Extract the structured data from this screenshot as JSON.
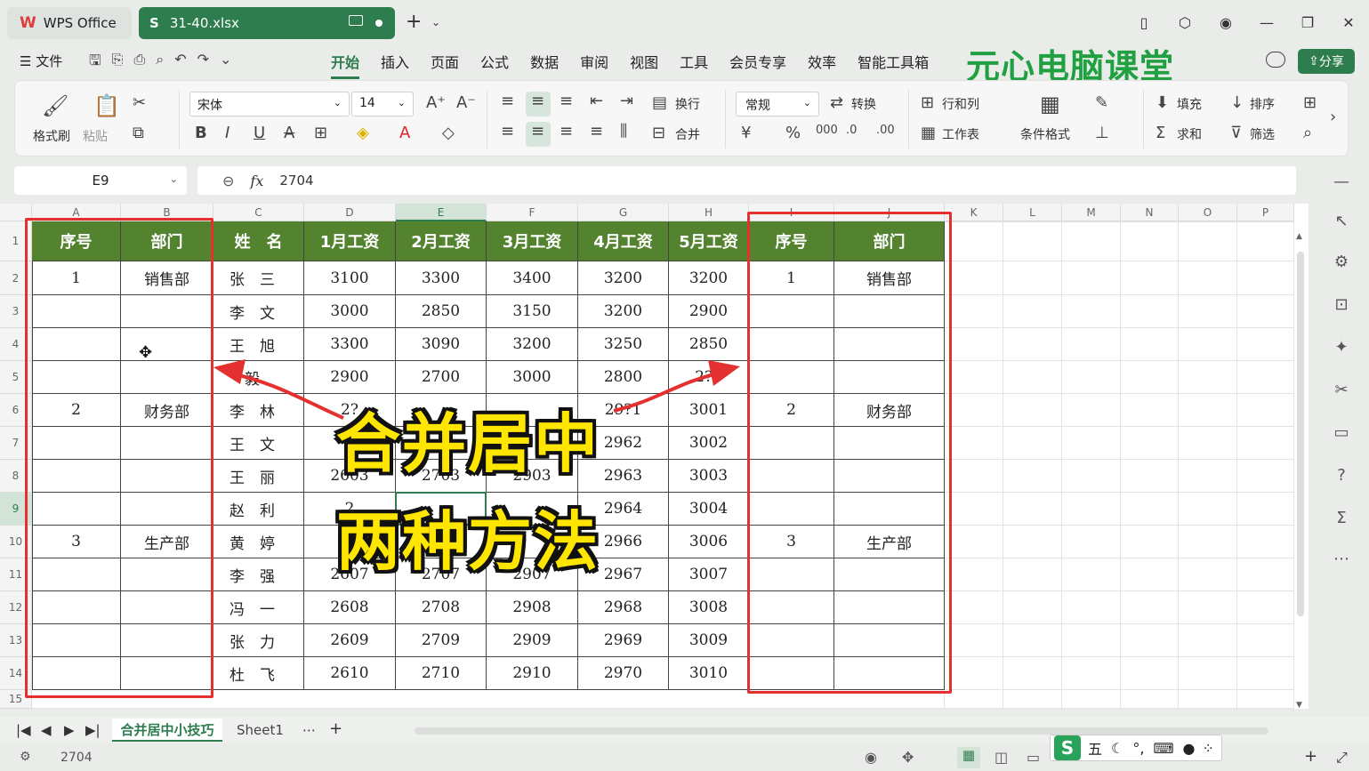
{
  "titlebar": {
    "app_tab": "WPS Office",
    "file_tab": "31-40.xlsx",
    "file_icon": "S"
  },
  "menu": {
    "file": "文件",
    "items": [
      "开始",
      "插入",
      "页面",
      "公式",
      "数据",
      "审阅",
      "视图",
      "工具",
      "会员专享",
      "效率",
      "智能工具箱"
    ],
    "active": "开始",
    "share": "分享"
  },
  "brand": "元心电脑课堂",
  "ribbon": {
    "format_painter": "格式刷",
    "paste": "粘贴",
    "font_name": "宋体",
    "font_size": "14",
    "wrap": "换行",
    "merge": "合并",
    "number_format": "常规",
    "convert": "转换",
    "row_col": "行和列",
    "worksheet": "工作表",
    "cond_format": "条件格式",
    "fill": "填充",
    "sort": "排序",
    "sum": "求和",
    "filter": "筛选"
  },
  "namebox": "E9",
  "formula_value": "2704",
  "columns": [
    "A",
    "B",
    "C",
    "D",
    "E",
    "F",
    "G",
    "H",
    "I",
    "J",
    "K",
    "L",
    "M",
    "N",
    "O",
    "P"
  ],
  "selected_column": "E",
  "rows": [
    "1",
    "2",
    "3",
    "4",
    "5",
    "6",
    "7",
    "8",
    "9",
    "10",
    "11",
    "12",
    "13",
    "14",
    "15"
  ],
  "selected_row": "9",
  "table": {
    "headers": [
      "序号",
      "部门",
      "姓　名",
      "1月工资",
      "2月工资",
      "3月工资",
      "4月工资",
      "5月工资",
      "序号",
      "部门"
    ],
    "rows": [
      [
        "1",
        "销售部",
        "张　三",
        "3100",
        "3300",
        "3400",
        "3200",
        "3200",
        "1",
        "销售部"
      ],
      [
        "",
        "",
        "李　文",
        "3000",
        "2850",
        "3150",
        "3200",
        "2900",
        "",
        ""
      ],
      [
        "",
        "",
        "王　旭",
        "3300",
        "3090",
        "3200",
        "3250",
        "2850",
        "",
        ""
      ],
      [
        "",
        "",
        "　毅",
        "2900",
        "2700",
        "3000",
        "2800",
        "2?0",
        "",
        ""
      ],
      [
        "2",
        "财务部",
        "李　林",
        "2?",
        "",
        "",
        "29?1",
        "3001",
        "2",
        "财务部"
      ],
      [
        "",
        "",
        "王　文",
        "2",
        "",
        "",
        "2962",
        "3002",
        "",
        ""
      ],
      [
        "",
        "",
        "王　丽",
        "2603",
        "2703",
        "2903",
        "2963",
        "3003",
        "",
        ""
      ],
      [
        "",
        "",
        "赵　利",
        "2",
        "",
        "",
        "2964",
        "3004",
        "",
        ""
      ],
      [
        "3",
        "生产部",
        "黄　婷",
        "2",
        "",
        "",
        "2966",
        "3006",
        "3",
        "生产部"
      ],
      [
        "",
        "",
        "李　强",
        "2607",
        "2707",
        "2907",
        "2967",
        "3007",
        "",
        ""
      ],
      [
        "",
        "",
        "冯　一",
        "2608",
        "2708",
        "2908",
        "2968",
        "3008",
        "",
        ""
      ],
      [
        "",
        "",
        "张　力",
        "2609",
        "2709",
        "2909",
        "2969",
        "3009",
        "",
        ""
      ],
      [
        "",
        "",
        "杜　飞",
        "2610",
        "2710",
        "2910",
        "2970",
        "3010",
        "",
        ""
      ]
    ]
  },
  "overlay": {
    "line1": "合并居中",
    "line2": "两种方法"
  },
  "sheet_tabs": [
    "合并居中小技巧",
    "Sheet1"
  ],
  "active_sheet": "合并居中小技巧",
  "status_value": "2704",
  "ime": {
    "label": "五"
  },
  "colors": {
    "accent": "#2e7d4f",
    "header_fill": "#54832f",
    "highlight_box": "#e53030",
    "overlay_text": "#ffe600",
    "brand": "#20a040"
  }
}
